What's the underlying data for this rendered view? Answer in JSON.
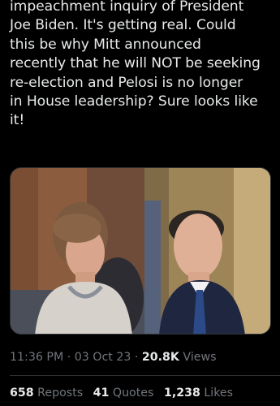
{
  "tweet": {
    "text": "impeachment inquiry of President\nJoe Biden. It's getting real. Could\nthis be why Mitt announced\nrecently that he will NOT be seeking\nre-election and Pelosi is no longer\nin House leadership? Sure looks like\nit!"
  },
  "media": {
    "left_image": "photo-woman-speaking",
    "right_image": "photo-man-smiling"
  },
  "meta": {
    "time": "11:36 PM",
    "separator": " · ",
    "date": "03 Oct 23",
    "views_count": "20.8K",
    "views_label": " Views"
  },
  "stats": {
    "reposts_count": "658",
    "reposts_label": " Reposts",
    "quotes_count": "41",
    "quotes_label": " Quotes",
    "likes_count": "1,238",
    "likes_label": " Likes"
  },
  "colors": {
    "background": "#000000",
    "text": "#e7e9ea",
    "secondary": "#71767b",
    "border": "#2f3336"
  }
}
